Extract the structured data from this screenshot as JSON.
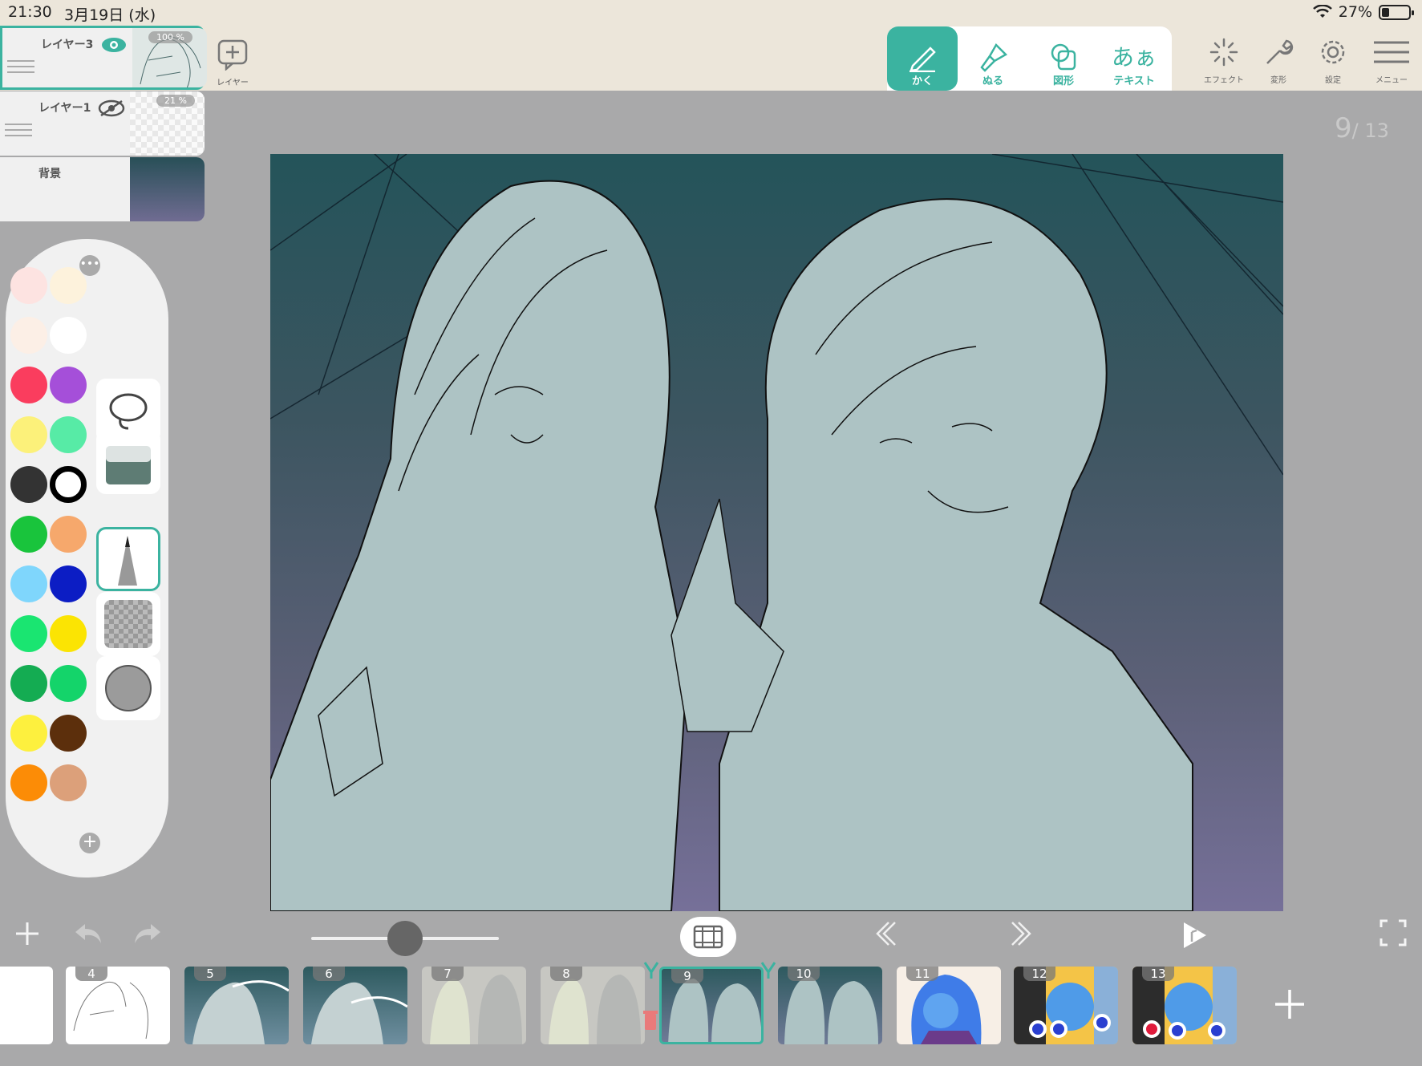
{
  "status_bar": {
    "time": "21:30",
    "date": "3月19日 (水)",
    "battery": "27%",
    "battery_level": 0.27
  },
  "layers": [
    {
      "name": "レイヤー3",
      "opacity": "100 %",
      "visible": true,
      "active": true
    },
    {
      "name": "レイヤー1",
      "opacity": "21 %",
      "visible": false,
      "active": false
    },
    {
      "name": "背景",
      "opacity": "",
      "visible": true,
      "active": false
    }
  ],
  "add_layer_label": "レイヤー",
  "tools": [
    {
      "label": "かく",
      "icon": "pencil-icon",
      "active": true
    },
    {
      "label": "ぬる",
      "icon": "brush-icon",
      "active": false
    },
    {
      "label": "図形",
      "icon": "shapes-icon",
      "active": false
    },
    {
      "label": "テキスト",
      "glyph": "あぁ",
      "icon": "text-icon",
      "active": false
    }
  ],
  "right_tools": [
    {
      "label": "エフェクト",
      "icon": "sparkle-icon"
    },
    {
      "label": "変形",
      "icon": "wrench-icon"
    },
    {
      "label": "設定",
      "icon": "gear-icon"
    },
    {
      "label": "メニュー",
      "icon": "hamburger-icon"
    }
  ],
  "page_counter": {
    "current": "9",
    "total": "/ 13"
  },
  "palette": {
    "colors": [
      "#fde3e1",
      "#fdf2dc",
      "#fcefe6",
      "#ffffff",
      "#fa3d5e",
      "#a54fd9",
      "#fcf17a",
      "#57eba6",
      "#333333",
      "#000000",
      "#19c43c",
      "#f6a86c",
      "#7fd6fc",
      "#0c1dc4",
      "#1ae571",
      "#fbe403",
      "#14ac52",
      "#14d46a",
      "#fdf03e",
      "#5c2f0c",
      "#fc8c06",
      "#dca07a"
    ],
    "tool_slots": [
      "lasso-icon",
      "eraser-icon",
      "pen-icon",
      "transparent-icon",
      "gray-color-icon"
    ],
    "selected_tool": "pen-icon"
  },
  "slider_value": 0.5,
  "frames": [
    {
      "num": "4"
    },
    {
      "num": "5"
    },
    {
      "num": "6"
    },
    {
      "num": "7"
    },
    {
      "num": "8"
    },
    {
      "num": "9",
      "selected": true
    },
    {
      "num": "10"
    },
    {
      "num": "11"
    },
    {
      "num": "12"
    },
    {
      "num": "13"
    }
  ],
  "colors": {
    "accent": "#3bb3a0"
  }
}
